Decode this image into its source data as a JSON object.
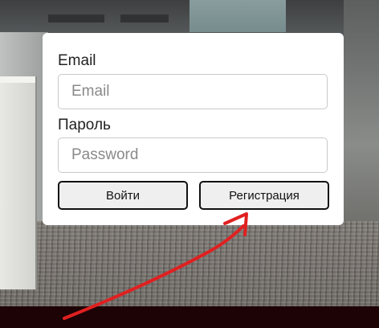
{
  "login_form": {
    "email_label": "Email",
    "email_placeholder": "Email",
    "email_value": "",
    "password_label": "Пароль",
    "password_placeholder": "Password",
    "password_value": "",
    "login_button_label": "Войти",
    "register_button_label": "Регистрация"
  },
  "annotation": {
    "arrow_color": "#e02020",
    "arrow_target": "register-button"
  },
  "colors": {
    "card_background": "#ffffff",
    "button_background": "#efefef",
    "button_border": "#111111",
    "footer_bar": "#1d0306"
  }
}
